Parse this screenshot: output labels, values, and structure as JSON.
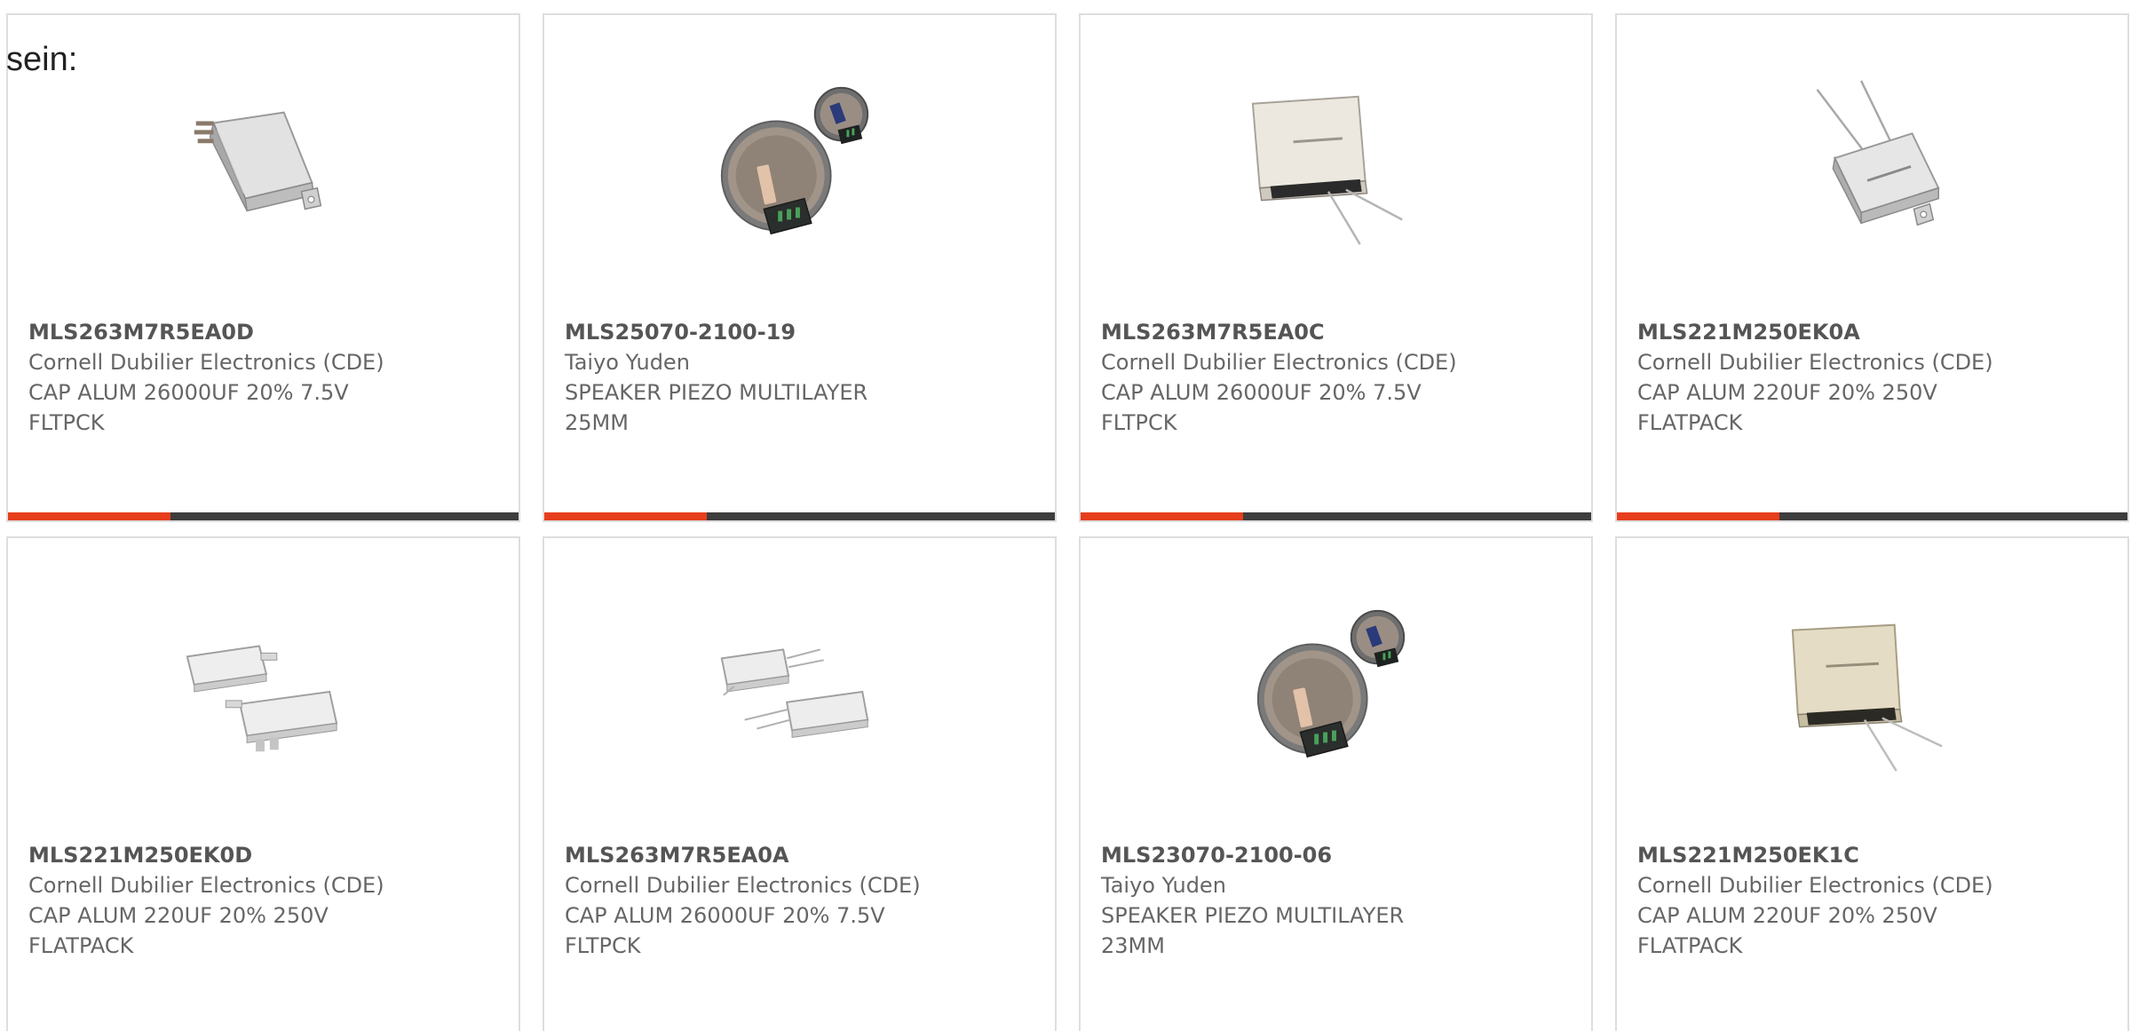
{
  "intro_text": "sein:",
  "colors": {
    "accent": "#e63e1d",
    "bar": "#3d3d3d",
    "border": "#dedede",
    "text": "#666666"
  },
  "products": [
    {
      "part_number": "MLS263M7R5EA0D",
      "manufacturer": "Cornell Dubilier Electronics (CDE)",
      "description": "CAP ALUM 26000UF 20% 7.5V\nFLTPCK",
      "image": "flatpack-capacitor-angled"
    },
    {
      "part_number": "MLS25070-2100-19",
      "manufacturer": "Taiyo Yuden",
      "description": "SPEAKER PIEZO MULTILAYER\n25MM",
      "image": "piezo-speaker"
    },
    {
      "part_number": "MLS263M7R5EA0C",
      "manufacturer": "Cornell Dubilier Electronics (CDE)",
      "description": "CAP ALUM 26000UF 20% 7.5V\nFLTPCK",
      "image": "flatpack-capacitor-leads"
    },
    {
      "part_number": "MLS221M250EK0A",
      "manufacturer": "Cornell Dubilier Electronics (CDE)",
      "description": "CAP ALUM 220UF 20% 250V\nFLATPACK",
      "image": "flatpack-capacitor-diamond"
    },
    {
      "part_number": "MLS221M250EK0D",
      "manufacturer": "Cornell Dubilier Electronics (CDE)",
      "description": "CAP ALUM 220UF 20% 250V\nFLATPACK",
      "image": "flatpack-capacitor-pair"
    },
    {
      "part_number": "MLS263M7R5EA0A",
      "manufacturer": "Cornell Dubilier Electronics (CDE)",
      "description": "CAP ALUM 26000UF 20% 7.5V\nFLTPCK",
      "image": "flatpack-capacitor-pair-leads"
    },
    {
      "part_number": "MLS23070-2100-06",
      "manufacturer": "Taiyo Yuden",
      "description": "SPEAKER PIEZO MULTILAYER\n23MM",
      "image": "piezo-speaker"
    },
    {
      "part_number": "MLS221M250EK1C",
      "manufacturer": "Cornell Dubilier Electronics (CDE)",
      "description": "CAP ALUM 220UF 20% 250V\nFLATPACK",
      "image": "flatpack-capacitor-leads-tan"
    }
  ]
}
